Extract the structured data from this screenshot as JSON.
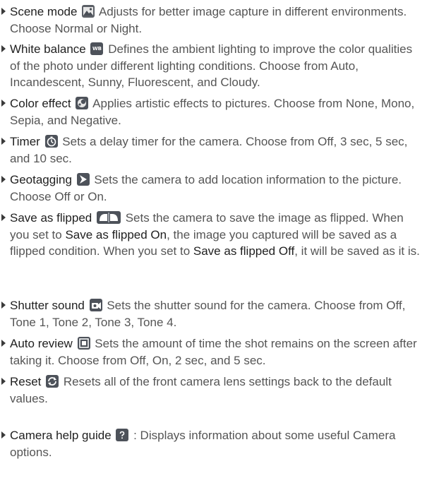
{
  "items": [
    {
      "title": "Scene mode",
      "icon": "scene-mode-icon",
      "text": " Adjusts for better image capture in different environments. Choose Normal or Night."
    },
    {
      "title": "White balance",
      "icon": "white-balance-icon",
      "icon_text": "WB",
      "text": " Defines the ambient lighting to improve the color qualities of the photo under different lighting conditions. Choose from Auto, Incandescent, Sunny, Fluorescent, and Cloudy."
    },
    {
      "title": "Color effect",
      "icon": "color-effect-icon",
      "text": " Applies artistic effects to pictures. Choose from None, Mono, Sepia, and Negative."
    },
    {
      "title": "Timer",
      "icon": "timer-icon",
      "text": " Sets a delay timer for the camera. Choose from Off, 3 sec, 5 sec, and 10 sec."
    },
    {
      "title": "Geotagging",
      "icon": "geotagging-icon",
      "text": " Sets the camera to add location information to the picture. Choose Off or On."
    },
    {
      "title": "Save as flipped",
      "icon": "save-as-flipped-icon",
      "text_a": " Sets the camera to save the image as flipped. When you set to ",
      "strong_a": "Save as flipped On",
      "text_b": ", the image you captured will be saved as a flipped condition. When you set to ",
      "strong_b": "Save as flipped Off",
      "text_c": ", it will be saved as it is."
    },
    {
      "title": "Shutter sound",
      "icon": "shutter-sound-icon",
      "text": " Sets the shutter sound for the camera. Choose from Off, Tone 1, Tone 2, Tone 3, Tone 4."
    },
    {
      "title": "Auto review",
      "icon": "auto-review-icon",
      "text": " Sets the amount of time the shot remains on the screen after taking it. Choose from Off, On, 2 sec, and 5 sec."
    },
    {
      "title": "Reset",
      "icon": "reset-icon",
      "text": " Resets all of the front camera lens settings back to the default values."
    },
    {
      "title": "Camera help guide",
      "icon": "help-guide-icon",
      "text": " : Displays information about some useful Camera options."
    }
  ]
}
